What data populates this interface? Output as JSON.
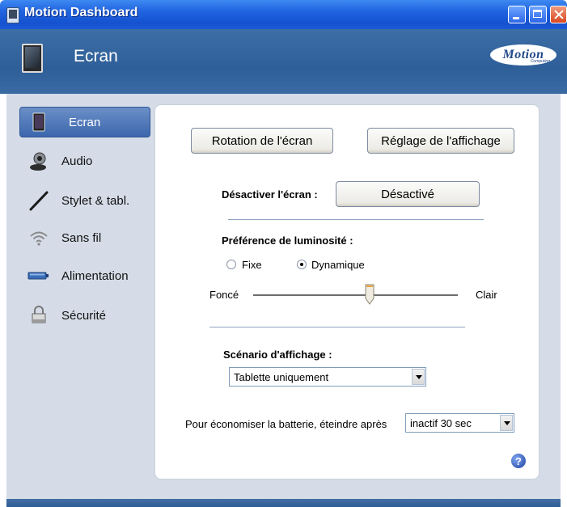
{
  "window": {
    "title": "Motion Dashboard"
  },
  "header": {
    "title": "Ecran",
    "logo_text": "Motion",
    "logo_sub": "Computing"
  },
  "sidebar": {
    "items": [
      {
        "label": "Ecran",
        "icon": "tablet-icon",
        "active": true
      },
      {
        "label": "Audio",
        "icon": "speaker-icon",
        "active": false
      },
      {
        "label": "Stylet & tabl.",
        "icon": "pen-icon",
        "active": false
      },
      {
        "label": "Sans fil",
        "icon": "wireless-icon",
        "active": false
      },
      {
        "label": "Alimentation",
        "icon": "battery-icon",
        "active": false
      },
      {
        "label": "Sécurité",
        "icon": "lock-icon",
        "active": false
      }
    ]
  },
  "main": {
    "rotation_button": "Rotation de l'écran",
    "display_settings_button": "Réglage de l'affichage",
    "disable_screen_label": "Désactiver l'écran :",
    "disable_screen_button": "Désactivé",
    "brightness_label": "Préférence de luminosité :",
    "radio_fixed": "Fixe",
    "radio_dynamic": "Dynamique",
    "brightness_selected": "Dynamique",
    "slider_min_label": "Foncé",
    "slider_max_label": "Clair",
    "brightness_level": 0.57,
    "scenario_label": "Scénario d'affichage :",
    "scenario_value": "Tablette uniquement",
    "battery_label": "Pour économiser la batterie, éteindre après",
    "battery_value": "inactif 30 sec",
    "help_symbol": "?"
  }
}
